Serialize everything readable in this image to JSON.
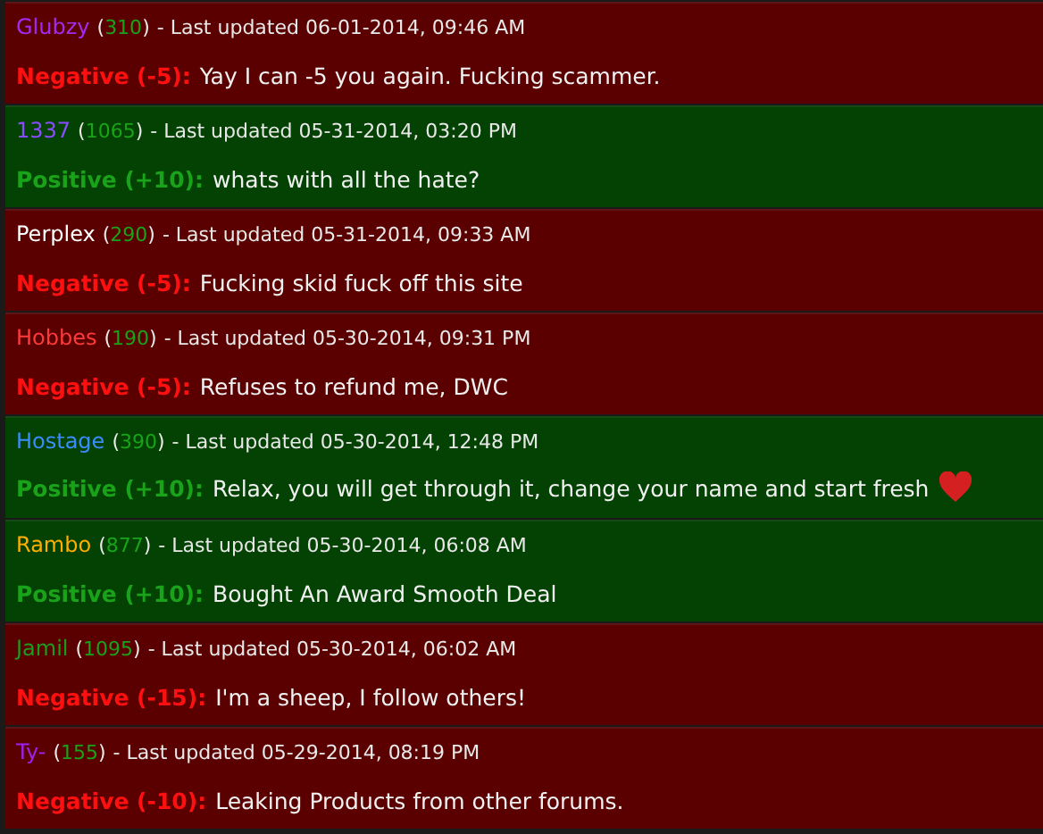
{
  "feedback": [
    {
      "kind": "negative",
      "user": "Glubzy",
      "color": "#a52af0",
      "score": "(310)",
      "updated": "- Last updated 06-01-2014, 09:46 AM",
      "rating": "Negative (-5):",
      "comment": "Yay I can -5 you again. Fucking scammer.",
      "heart": false
    },
    {
      "kind": "positive",
      "user": "1337",
      "color": "#8a4cff",
      "score": "(1065)",
      "updated": "- Last updated 05-31-2014, 03:20 PM",
      "rating": "Positive (+10):",
      "comment": "whats with all the hate?",
      "heart": false
    },
    {
      "kind": "negative",
      "user": "Perplex",
      "color": "#ffffff",
      "score": "(290)",
      "updated": "- Last updated 05-31-2014, 09:33 AM",
      "rating": "Negative (-5):",
      "comment": "Fucking skid fuck off this site",
      "heart": false
    },
    {
      "kind": "negative",
      "user": "Hobbes",
      "color": "#ff3a3a",
      "score": "(190)",
      "updated": "- Last updated 05-30-2014, 09:31 PM",
      "rating": "Negative (-5):",
      "comment": "Refuses to refund me, DWC",
      "heart": false
    },
    {
      "kind": "positive",
      "user": "Hostage",
      "color": "#3a8cff",
      "score": "(390)",
      "updated": "- Last updated 05-30-2014, 12:48 PM",
      "rating": "Positive (+10):",
      "comment": "Relax, you will get through it, change your name and start fresh",
      "heart": true
    },
    {
      "kind": "positive",
      "user": "Rambo",
      "color": "#ffae00",
      "score": "(877)",
      "updated": "- Last updated 05-30-2014, 06:08 AM",
      "rating": "Positive (+10):",
      "comment": "Bought An Award Smooth Deal",
      "heart": false
    },
    {
      "kind": "negative",
      "user": "Jamil",
      "color": "#1f9a1f",
      "score": "(1095)",
      "updated": "- Last updated 05-30-2014, 06:02 AM",
      "rating": "Negative (-15):",
      "comment": "I'm a sheep, I follow others!",
      "heart": false
    },
    {
      "kind": "negative",
      "user": "Ty-",
      "color": "#a020f0",
      "score": "(155)",
      "updated": "- Last updated 05-29-2014, 08:19 PM",
      "rating": "Negative (-10):",
      "comment": "Leaking Products from other forums.",
      "heart": false
    }
  ]
}
